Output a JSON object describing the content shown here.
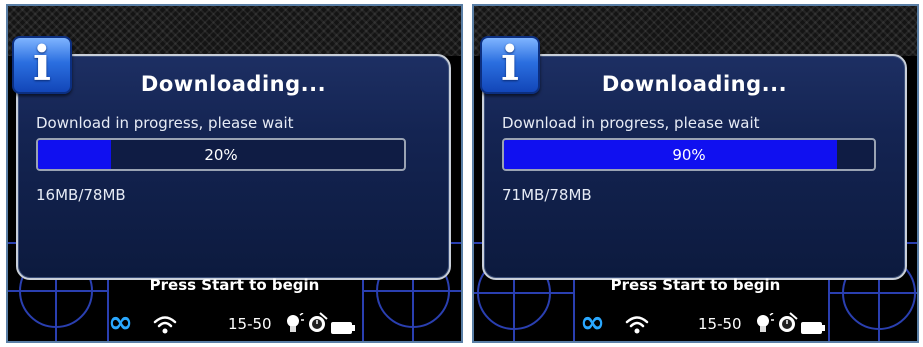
{
  "screens": [
    {
      "title": "Downloading...",
      "message": "Download in progress, please wait",
      "progress_label": "20%",
      "progress_fraction": 0.2,
      "size_text": "16MB/78MB",
      "prompt": "Press Start to begin",
      "time": "15-50"
    },
    {
      "title": "Downloading...",
      "message": "Download in progress, please wait",
      "progress_label": "90%",
      "progress_fraction": 0.9,
      "size_text": "71MB/78MB",
      "prompt": "Press Start to begin",
      "time": "15-50"
    }
  ],
  "icons": {
    "info": "info-icon",
    "infinity": "infinity-icon",
    "wifi": "wifi-icon",
    "bulb": "bulb-icon",
    "alarm": "alarm-icon",
    "battery": "battery-icon"
  },
  "colors": {
    "progress_fill": "#1010f0",
    "dialog_bg": "#142452",
    "grid_lines": "#2a3fb0",
    "infinity": "#2aa8ff"
  }
}
